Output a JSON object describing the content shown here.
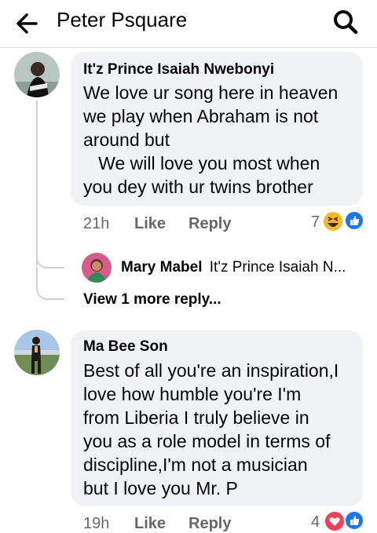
{
  "header": {
    "title": "Peter Psquare"
  },
  "comments": [
    {
      "author": "It'z Prince Isaiah Nwebonyi",
      "text": "We love ur song here in heaven\nwe play when Abraham is not\naround but\n   We will love you most when\nyou dey with ur twins brother",
      "time": "21h",
      "like": "Like",
      "reply": "Reply",
      "reactions_count": "7",
      "reply_preview": {
        "author": "Mary Mabel",
        "text": "It'z Prince Isaiah N..."
      },
      "more_replies": "View 1 more reply..."
    },
    {
      "author": "Ma Bee Son",
      "text": "Best of all you're an inspiration,I\nlove how humble you're I'm\nfrom Liberia I truly believe in\nyou as a role model in terms of\ndiscipline,I'm not a musician\nbut I love you Mr. P",
      "time": "19h",
      "like": "Like",
      "reply": "Reply",
      "reactions_count": "4"
    }
  ],
  "colors": {
    "accent": "#1877f2",
    "haha": "#f7b928",
    "love": "#f33e58",
    "bubble": "#f0f2f5"
  }
}
